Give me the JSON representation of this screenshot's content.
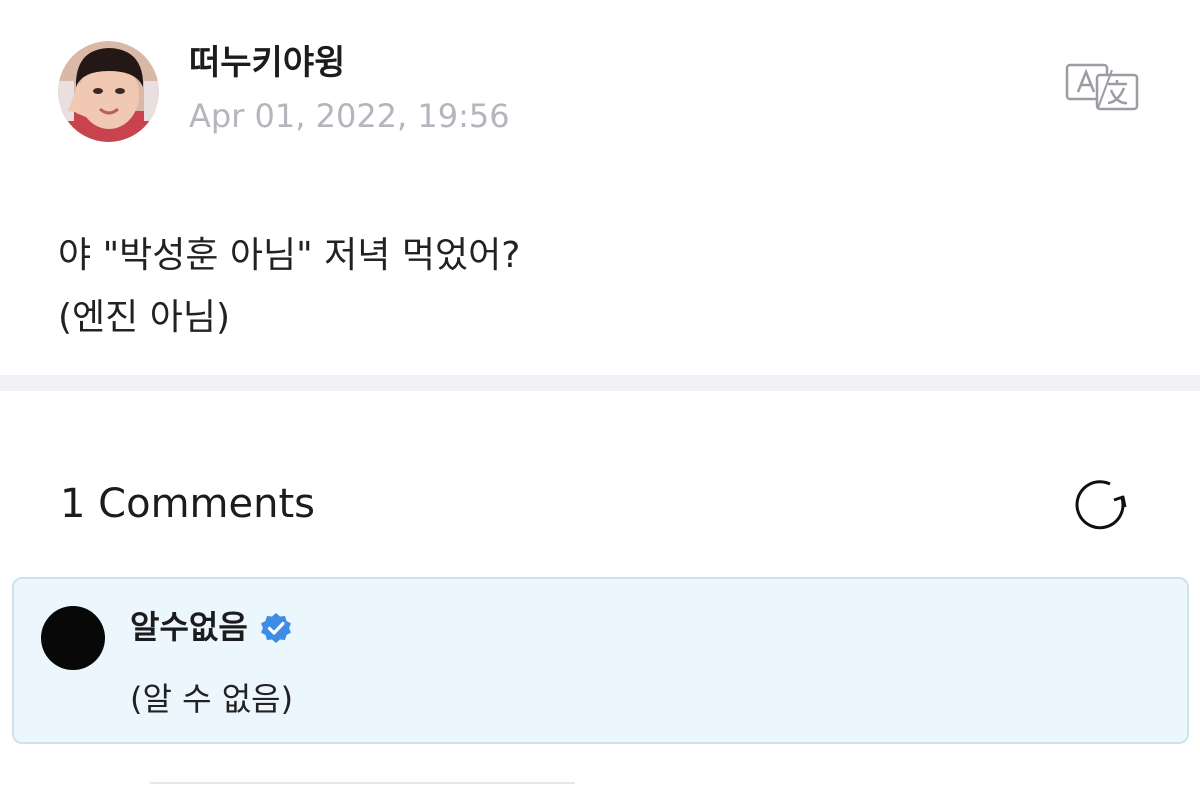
{
  "post": {
    "author_name": "떠누키야윙",
    "date": "Apr 01, 2022, 19:56",
    "avatar": "user-avatar-photo",
    "translate_icon": "translate-icon",
    "body_lines": [
      "야 \"박성훈 아님\" 저녁 먹었어?",
      "(엔진 아님)"
    ]
  },
  "comments": {
    "title": "1 Comments",
    "refresh_icon": "refresh-icon",
    "items": [
      {
        "author": "알수없음",
        "verified": true,
        "verified_icon": "verified-badge-icon",
        "text": "(알 수 없음)",
        "avatar_color": "#080808"
      }
    ]
  },
  "colors": {
    "accent_blue": "#3d8ce6",
    "comment_bg": "#ecf6fd",
    "comment_border": "#cfe3ee",
    "date_gray": "#b3b6bc",
    "divider": "#f1f2f5"
  }
}
